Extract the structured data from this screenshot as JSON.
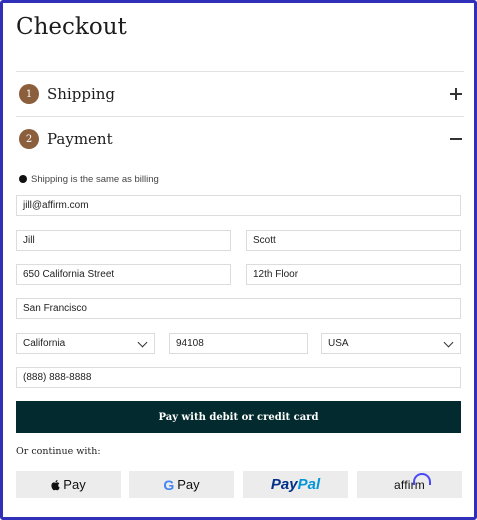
{
  "page": {
    "title": "Checkout"
  },
  "sections": {
    "shipping": {
      "step": "1",
      "label": "Shipping",
      "toggle": "+"
    },
    "payment": {
      "step": "2",
      "label": "Payment",
      "toggle": "−"
    }
  },
  "billing": {
    "same_as_shipping_label": "Shipping is the same as billing",
    "selected": true
  },
  "form": {
    "email": "jill@affirm.com",
    "first_name": "Jill",
    "last_name": "Scott",
    "address1": "650 California Street",
    "address2": "12th Floor",
    "city": "San Francisco",
    "state": "California",
    "zip": "94108",
    "country": "USA",
    "phone": "(888) 888-8888"
  },
  "actions": {
    "pay_card_label": "Pay with debit or credit card",
    "continue_with_label": "Or continue with:"
  },
  "wallets": {
    "apple_pay": "Pay",
    "google_pay_g": "G",
    "google_pay": "Pay",
    "paypal_pay": "Pay",
    "paypal_pal": "Pal",
    "affirm": "affirm"
  },
  "colors": {
    "frame_border": "#2f2fb8",
    "step_badge": "#8b5e3c",
    "pay_button": "#032a2e",
    "wallet_button": "#ececec",
    "paypal_dark": "#003087",
    "paypal_light": "#0096d7",
    "affirm_arc": "#4a4af4"
  }
}
